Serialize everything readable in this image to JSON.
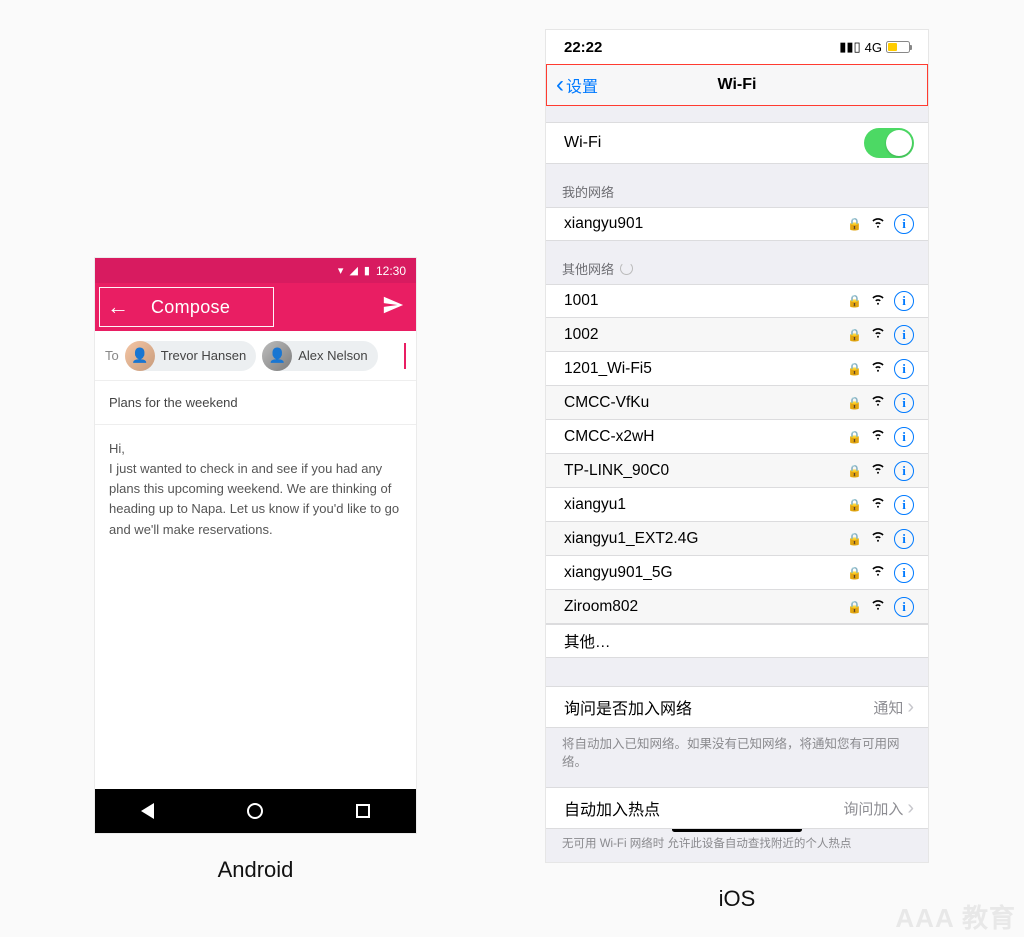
{
  "labels": {
    "android": "Android",
    "ios": "iOS"
  },
  "watermark": "AAA 教育",
  "android": {
    "status": {
      "time": "12:30"
    },
    "appbar": {
      "title": "Compose"
    },
    "to_label": "To",
    "recipients": [
      {
        "name": "Trevor Hansen"
      },
      {
        "name": "Alex Nelson"
      }
    ],
    "subject": "Plans for the weekend",
    "body_greeting": "Hi,",
    "body_text": "I just wanted to check in and see if you had any plans this upcoming weekend. We are thinking of heading up to Napa. Let us know if you'd like to go and we'll make reservations."
  },
  "ios": {
    "status": {
      "time": "22:22",
      "network": "4G"
    },
    "nav": {
      "back": "设置",
      "title": "Wi-Fi"
    },
    "wifi_row_label": "Wi-Fi",
    "section_my": "我的网络",
    "my_networks": [
      {
        "name": "xiangyu901",
        "locked": true
      }
    ],
    "section_other": "其他网络",
    "other_networks": [
      {
        "name": "1001",
        "locked": true
      },
      {
        "name": "1002",
        "locked": true
      },
      {
        "name": "1201_Wi-Fi5",
        "locked": true
      },
      {
        "name": "CMCC-VfKu",
        "locked": true
      },
      {
        "name": "CMCC-x2wH",
        "locked": true
      },
      {
        "name": "TP-LINK_90C0",
        "locked": true
      },
      {
        "name": "xiangyu1",
        "locked": true
      },
      {
        "name": "xiangyu1_EXT2.4G",
        "locked": true
      },
      {
        "name": "xiangyu901_5G",
        "locked": true
      },
      {
        "name": "Ziroom802",
        "locked": true
      }
    ],
    "other_item_label": "其他…",
    "ask_to_join": {
      "label": "询问是否加入网络",
      "value": "通知"
    },
    "ask_footer": "将自动加入已知网络。如果没有已知网络，将通知您有可用网络。",
    "auto_join_hotspot": {
      "label": "自动加入热点",
      "value": "询问加入"
    },
    "bottom_truncated": "无可用 Wi-Fi 网络时    允许此设备自动查找附近的个人热点"
  }
}
